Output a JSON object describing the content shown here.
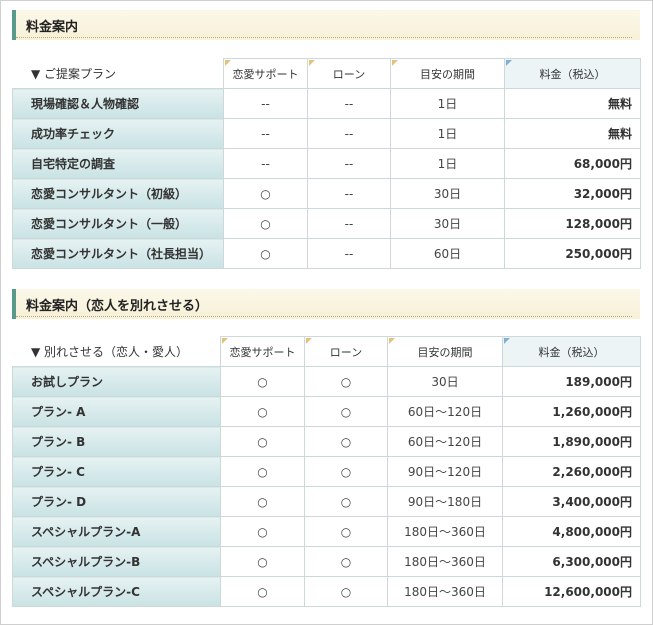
{
  "section1": {
    "title": "料金案内",
    "caption": "▼ ご提案プラン",
    "headers": [
      "恋愛サポート",
      "ローン",
      "目安の期間",
      "料金（税込）"
    ],
    "rows": [
      {
        "name": "現場確認＆人物確認",
        "support": "--",
        "loan": "--",
        "period": "1日",
        "price": "無料"
      },
      {
        "name": "成功率チェック",
        "support": "--",
        "loan": "--",
        "period": "1日",
        "price": "無料"
      },
      {
        "name": "自宅特定の調査",
        "support": "--",
        "loan": "--",
        "period": "1日",
        "price": "68,000円"
      },
      {
        "name": "恋愛コンサルタント（初級）",
        "support": "○",
        "loan": "--",
        "period": "30日",
        "price": "32,000円"
      },
      {
        "name": "恋愛コンサルタント（一般）",
        "support": "○",
        "loan": "--",
        "period": "30日",
        "price": "128,000円"
      },
      {
        "name": "恋愛コンサルタント（社長担当）",
        "support": "○",
        "loan": "--",
        "period": "60日",
        "price": "250,000円"
      }
    ]
  },
  "section2": {
    "title": "料金案内（恋人を別れさせる）",
    "caption": "▼ 別れさせる（恋人・愛人）",
    "headers": [
      "恋愛サポート",
      "ローン",
      "目安の期間",
      "料金（税込）"
    ],
    "rows": [
      {
        "name": "お試しプラン",
        "support": "○",
        "loan": "○",
        "period": "30日",
        "price": "189,000円"
      },
      {
        "name": "プラン- A",
        "support": "○",
        "loan": "○",
        "period": "60日～120日",
        "price": "1,260,000円"
      },
      {
        "name": "プラン- B",
        "support": "○",
        "loan": "○",
        "period": "60日～120日",
        "price": "1,890,000円"
      },
      {
        "name": "プラン- C",
        "support": "○",
        "loan": "○",
        "period": "90日～120日",
        "price": "2,260,000円"
      },
      {
        "name": "プラン- D",
        "support": "○",
        "loan": "○",
        "period": "90日～180日",
        "price": "3,400,000円"
      },
      {
        "name": "スペシャルプラン-A",
        "support": "○",
        "loan": "○",
        "period": "180日～360日",
        "price": "4,800,000円"
      },
      {
        "name": "スペシャルプラン-B",
        "support": "○",
        "loan": "○",
        "period": "180日～360日",
        "price": "6,300,000円"
      },
      {
        "name": "スペシャルプラン-C",
        "support": "○",
        "loan": "○",
        "period": "180日～360日",
        "price": "12,600,000円"
      }
    ]
  }
}
